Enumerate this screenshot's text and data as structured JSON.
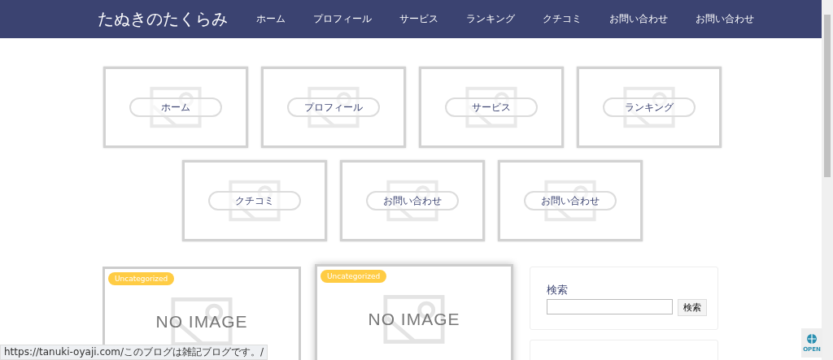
{
  "header": {
    "site_title": "たぬきのたくらみ",
    "nav": [
      {
        "label": "ホーム"
      },
      {
        "label": "プロフィール"
      },
      {
        "label": "サービス"
      },
      {
        "label": "ランキング"
      },
      {
        "label": "クチコミ"
      },
      {
        "label": "お問い合わせ"
      },
      {
        "label": "お問い合わせ"
      }
    ]
  },
  "menu_cards": [
    {
      "label": "ホーム"
    },
    {
      "label": "プロフィール"
    },
    {
      "label": "サービス"
    },
    {
      "label": "ランキング"
    },
    {
      "label": "クチコミ"
    },
    {
      "label": "お問い合わせ"
    },
    {
      "label": "お問い合わせ"
    }
  ],
  "posts": [
    {
      "category": "Uncategorized",
      "image_text": "NO IMAGE",
      "hovered": false
    },
    {
      "category": "Uncategorized",
      "image_text": "NO IMAGE",
      "hovered": true
    }
  ],
  "sidebar": {
    "search_widget": {
      "title": "検索",
      "button": "検索"
    }
  },
  "open_badge": {
    "label": "OPEN"
  },
  "status_bar": {
    "url": "https://tanuki-oyaji.com/このブログは雑記ブログです。/"
  }
}
